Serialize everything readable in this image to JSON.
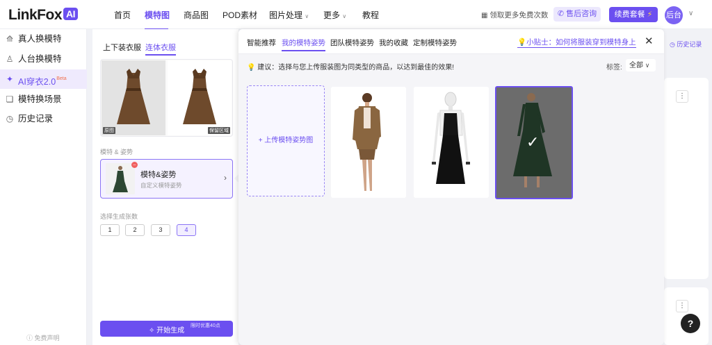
{
  "header": {
    "logo_text": "LinkFox",
    "logo_badge": "AI",
    "nav": [
      {
        "label": "首页",
        "active": false
      },
      {
        "label": "模特图",
        "active": true
      },
      {
        "label": "商品图",
        "active": false
      },
      {
        "label": "POD素材",
        "active": false
      },
      {
        "label": "图片处理",
        "active": false,
        "dropdown": true
      },
      {
        "label": "更多",
        "active": false,
        "dropdown": true
      },
      {
        "label": "教程",
        "active": false
      }
    ],
    "promo_text": "领取更多免费次数",
    "support_label": "售后咨询",
    "renew_label": "续费套餐",
    "avatar_text": "后台"
  },
  "sidebar": {
    "items": [
      {
        "label": "真人换模特",
        "icon": "shirt-icon",
        "active": false
      },
      {
        "label": "人台换模特",
        "icon": "mannequin-icon",
        "active": false
      },
      {
        "label": "AI穿衣2.0",
        "icon": "ai-dress-icon",
        "active": true,
        "badge": "Beta"
      },
      {
        "label": "模特换场景",
        "icon": "scene-icon",
        "active": false
      },
      {
        "label": "历史记录",
        "icon": "clock-icon",
        "active": false
      }
    ],
    "disclaimer": "免费声明"
  },
  "config": {
    "tabs": [
      {
        "label": "上下装衣服",
        "active": false
      },
      {
        "label": "连体衣服",
        "active": true
      }
    ],
    "original_tag": "原图",
    "keep_area_tag": "保留区域",
    "model_section_label": "模特 & 姿势",
    "model_card_title": "模特&姿势",
    "model_card_subtitle": "自定义模特姿势",
    "count_section_label": "选择生成张数",
    "counts": [
      {
        "label": "1",
        "selected": false
      },
      {
        "label": "2",
        "selected": false
      },
      {
        "label": "3",
        "selected": false
      },
      {
        "label": "4",
        "selected": true
      }
    ],
    "start_label": "开始生成",
    "start_badge": "限时优惠40点"
  },
  "popup": {
    "tabs": [
      {
        "label": "智能推荐",
        "active": false
      },
      {
        "label": "我的模特姿势",
        "active": true
      },
      {
        "label": "团队模特姿势",
        "active": false
      },
      {
        "label": "我的收藏",
        "active": false
      },
      {
        "label": "定制模特姿势",
        "active": false
      }
    ],
    "tip_text": "小贴士：如何将服装穿到模特身上",
    "suggestion": "建议：选择与您上传服装图为同类型的商品，以达到最佳的效果!",
    "tag_label": "标签:",
    "tag_value": "全部",
    "upload_label": "+ 上传模特姿势图",
    "models": [
      {
        "name": "brown-suit-model",
        "selected": false
      },
      {
        "name": "black-dress-mannequin",
        "selected": false
      },
      {
        "name": "green-dress-model",
        "selected": true
      }
    ]
  },
  "background": {
    "history_label": "历史记录"
  },
  "colors": {
    "accent": "#6b4ff0",
    "accent_light": "#efeafd",
    "popup_bg": "#f5f5f8"
  }
}
